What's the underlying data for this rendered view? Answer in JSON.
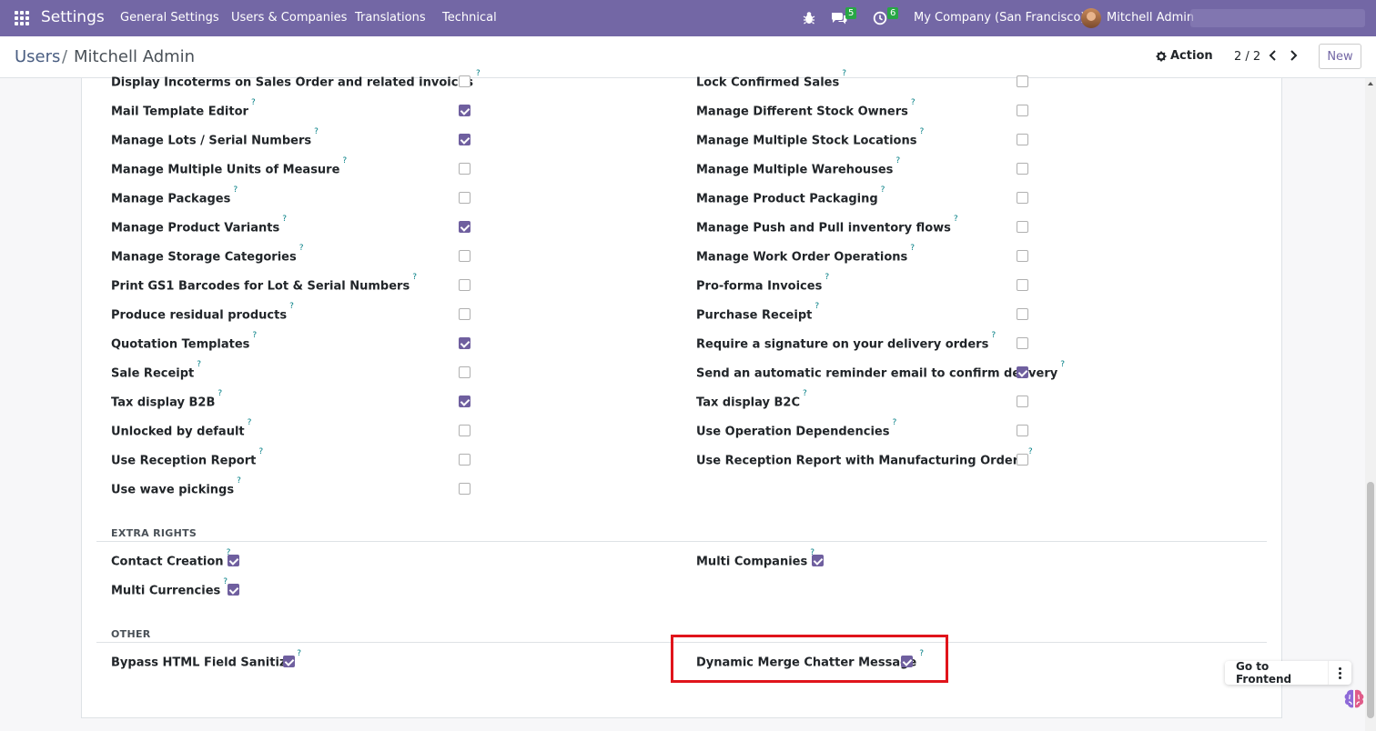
{
  "navbar": {
    "app_title": "Settings",
    "menus": [
      "General Settings",
      "Users & Companies",
      "Translations",
      "Technical"
    ],
    "chat_count": "5",
    "activity_count": "6",
    "company": "My Company (San Francisco)",
    "user": "Mitchell Admin"
  },
  "breadcrumb": {
    "parent": "Users",
    "separator": "/",
    "current": "Mitchell Admin"
  },
  "toolbar": {
    "action_label": "Action",
    "pager": "2 / 2",
    "new_label": "New"
  },
  "technical": {
    "left": [
      {
        "label": "Display Incoterms on Sales Order and related invoices",
        "checked": false
      },
      {
        "label": "Mail Template Editor",
        "checked": true
      },
      {
        "label": "Manage Lots / Serial Numbers",
        "checked": true
      },
      {
        "label": "Manage Multiple Units of Measure",
        "checked": false
      },
      {
        "label": "Manage Packages",
        "checked": false
      },
      {
        "label": "Manage Product Variants",
        "checked": true
      },
      {
        "label": "Manage Storage Categories",
        "checked": false
      },
      {
        "label": "Print GS1 Barcodes for Lot & Serial Numbers",
        "checked": false
      },
      {
        "label": "Produce residual products",
        "checked": false
      },
      {
        "label": "Quotation Templates",
        "checked": true
      },
      {
        "label": "Sale Receipt",
        "checked": false
      },
      {
        "label": "Tax display B2B",
        "checked": true
      },
      {
        "label": "Unlocked by default",
        "checked": false
      },
      {
        "label": "Use Reception Report",
        "checked": false
      },
      {
        "label": "Use wave pickings",
        "checked": false
      }
    ],
    "right": [
      {
        "label": "Lock Confirmed Sales",
        "checked": false
      },
      {
        "label": "Manage Different Stock Owners",
        "checked": false
      },
      {
        "label": "Manage Multiple Stock Locations",
        "checked": false
      },
      {
        "label": "Manage Multiple Warehouses",
        "checked": false
      },
      {
        "label": "Manage Product Packaging",
        "checked": false
      },
      {
        "label": "Manage Push and Pull inventory flows",
        "checked": false
      },
      {
        "label": "Manage Work Order Operations",
        "checked": false
      },
      {
        "label": "Pro-forma Invoices",
        "checked": false
      },
      {
        "label": "Purchase Receipt",
        "checked": false
      },
      {
        "label": "Require a signature on your delivery orders",
        "checked": false
      },
      {
        "label": "Send an automatic reminder email to confirm delivery",
        "checked": true
      },
      {
        "label": "Tax display B2C",
        "checked": false
      },
      {
        "label": "Use Operation Dependencies",
        "checked": false
      },
      {
        "label": "Use Reception Report with Manufacturing Orders",
        "checked": false
      }
    ]
  },
  "extra_rights": {
    "title": "EXTRA RIGHTS",
    "contact_creation": {
      "label": "Contact Creation",
      "checked": true
    },
    "multi_companies": {
      "label": "Multi Companies",
      "checked": true
    },
    "multi_currencies": {
      "label": "Multi Currencies",
      "checked": true
    }
  },
  "other": {
    "title": "OTHER",
    "bypass_html": {
      "label": "Bypass HTML Field Sanitize",
      "checked": true
    },
    "dynamic_merge": {
      "label": "Dynamic Merge Chatter Message",
      "checked": true
    }
  },
  "help_mark": "?",
  "frontend": {
    "label": "Go to Frontend"
  },
  "colors": {
    "navbar": "#7367a5",
    "checkbox_checked": "#6f5f9f",
    "highlight": "#e0141b",
    "badge": "#28a745"
  }
}
